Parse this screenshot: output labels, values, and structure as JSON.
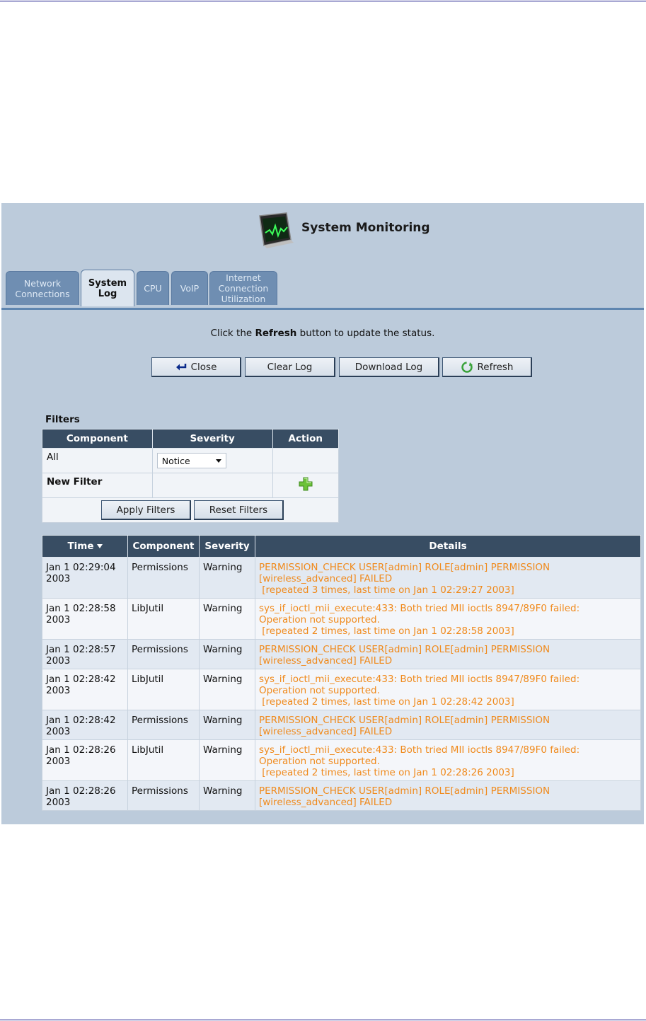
{
  "header": {
    "title": "System Monitoring"
  },
  "tabs": [
    {
      "label_lines": [
        "Network",
        "Connections"
      ],
      "active": false
    },
    {
      "label_lines": [
        "System",
        "Log"
      ],
      "active": true
    },
    {
      "label_lines": [
        "CPU"
      ],
      "active": false
    },
    {
      "label_lines": [
        "VoIP"
      ],
      "active": false
    },
    {
      "label_lines": [
        "Internet",
        "Connection",
        "Utilization"
      ],
      "active": false
    }
  ],
  "instruction": {
    "before": "Click the ",
    "bold": "Refresh",
    "after": " button to update the status."
  },
  "buttons": {
    "close": "Close",
    "clear_log": "Clear Log",
    "download_log": "Download Log",
    "refresh": "Refresh"
  },
  "filters": {
    "title": "Filters",
    "headers": [
      "Component",
      "Severity",
      "Action"
    ],
    "row_all": {
      "component": "All",
      "severity_selected": "Notice"
    },
    "new_filter_label": "New Filter",
    "apply_label": "Apply Filters",
    "reset_label": "Reset Filters"
  },
  "log": {
    "headers": [
      "Time",
      "Component",
      "Severity",
      "Details"
    ],
    "rows": [
      {
        "time": "Jan 1 02:29:04 2003",
        "component": "Permissions",
        "severity": "Warning",
        "details": [
          "PERMISSION_CHECK USER[admin] ROLE[admin] PERMISSION",
          "[wireless_advanced] FAILED",
          " [repeated 3 times, last time on Jan 1 02:29:27 2003]"
        ]
      },
      {
        "time": "Jan 1 02:28:58 2003",
        "component": "LibJutil",
        "severity": "Warning",
        "details": [
          "sys_if_ioctl_mii_execute:433: Both tried MII ioctls 8947/89F0 failed:",
          "Operation not supported.",
          " [repeated 2 times, last time on Jan 1 02:28:58 2003]"
        ]
      },
      {
        "time": "Jan 1 02:28:57 2003",
        "component": "Permissions",
        "severity": "Warning",
        "details": [
          "PERMISSION_CHECK USER[admin] ROLE[admin] PERMISSION",
          "[wireless_advanced] FAILED"
        ]
      },
      {
        "time": "Jan 1 02:28:42 2003",
        "component": "LibJutil",
        "severity": "Warning",
        "details": [
          "sys_if_ioctl_mii_execute:433: Both tried MII ioctls 8947/89F0 failed:",
          "Operation not supported.",
          " [repeated 2 times, last time on Jan 1 02:28:42 2003]"
        ]
      },
      {
        "time": "Jan 1 02:28:42 2003",
        "component": "Permissions",
        "severity": "Warning",
        "details": [
          "PERMISSION_CHECK USER[admin] ROLE[admin] PERMISSION",
          "[wireless_advanced] FAILED"
        ]
      },
      {
        "time": "Jan 1 02:28:26 2003",
        "component": "LibJutil",
        "severity": "Warning",
        "details": [
          "sys_if_ioctl_mii_execute:433: Both tried MII ioctls 8947/89F0 failed:",
          "Operation not supported.",
          " [repeated 2 times, last time on Jan 1 02:28:26 2003]"
        ]
      },
      {
        "time": "Jan 1 02:28:26 2003",
        "component": "Permissions",
        "severity": "Warning",
        "details": [
          "PERMISSION_CHECK USER[admin] ROLE[admin] PERMISSION",
          "[wireless_advanced] FAILED"
        ]
      }
    ]
  },
  "colors": {
    "background": "#bccbdb",
    "header_cell": "#384d63",
    "details_text": "#f08a1c",
    "page_rule": "#1a1a8a"
  }
}
